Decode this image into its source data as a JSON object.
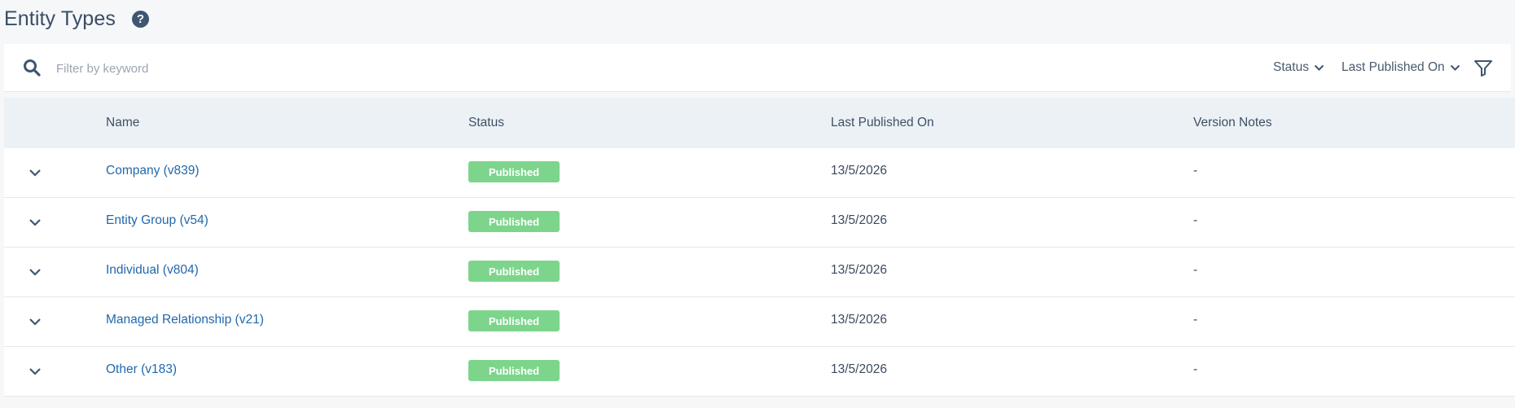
{
  "page": {
    "title": "Entity Types",
    "help_icon": "question-circle-icon",
    "help_glyph": "?"
  },
  "toolbar": {
    "search_placeholder": "Filter by keyword",
    "search_value": "",
    "status_dropdown_label": "Status",
    "last_published_dropdown_label": "Last Published On",
    "filter_icon": "filter-funnel-icon"
  },
  "table": {
    "columns": {
      "name": "Name",
      "status": "Status",
      "last_published": "Last Published On",
      "version_notes": "Version Notes"
    },
    "rows": [
      {
        "name": "Company (v839)",
        "status": "Published",
        "last_published": "13/5/2026",
        "version_notes": "-"
      },
      {
        "name": "Entity Group (v54)",
        "status": "Published",
        "last_published": "13/5/2026",
        "version_notes": "-"
      },
      {
        "name": "Individual (v804)",
        "status": "Published",
        "last_published": "13/5/2026",
        "version_notes": "-"
      },
      {
        "name": "Managed Relationship (v21)",
        "status": "Published",
        "last_published": "13/5/2026",
        "version_notes": "-"
      },
      {
        "name": "Other (v183)",
        "status": "Published",
        "last_published": "13/5/2026",
        "version_notes": "-"
      }
    ]
  },
  "colors": {
    "background": "#f5f7f9",
    "header_row": "#ecf1f5",
    "link": "#2168ad",
    "status_published": "#7dd58c",
    "icon": "#3f5670"
  }
}
